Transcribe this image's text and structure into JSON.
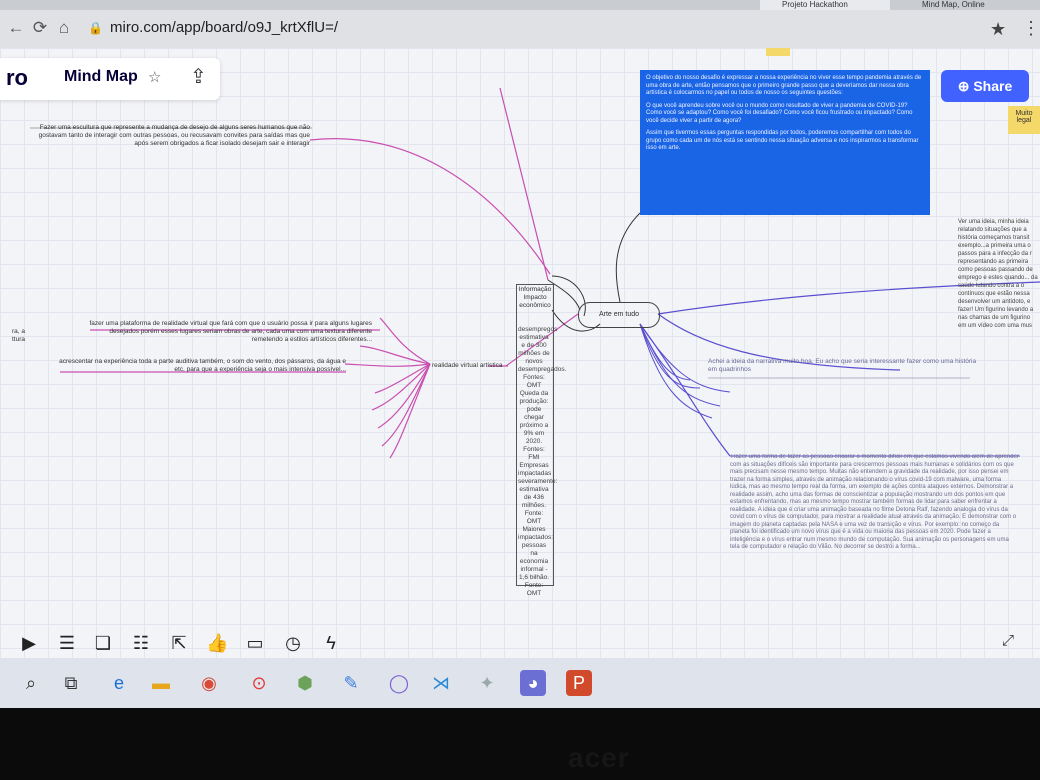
{
  "browser": {
    "tabs": [
      {
        "label": "Projeto Hackathon"
      },
      {
        "label": "Mind Map, Online"
      }
    ],
    "url": "miro.com/app/board/o9J_krtXflU=/"
  },
  "miro": {
    "logo": "ro",
    "board_title": "Mind Map",
    "share_label": "Share",
    "sticky_note": "Muito legal"
  },
  "mindmap": {
    "central": "Arte em tudo",
    "sub_node": "Informação Impacto econômico",
    "center_column": "desempregos estimativa e de 300 milhões de novos desempregados. Fontes: OMT Queda da produção: pode chegar próximo a 9% em 2020. Fontes: FMI Empresas impactadas severamente: estimativa de 436 milhões. Fonte: OMT Maiores impactados: pessoas na economia informal - 1,6 bilhão. Fonte: OMT",
    "branch_label": "realidade virtual artística",
    "left_text_1": "Fazer uma escultura que represente a mudança de desejo de alguns seres humanos que não gostavam tanto de interagir com outras pessoas, ou recusavam convites para saídas mas que após serem obrigados a ficar isolado desejam sair e interagir",
    "left_text_2": "fazer uma plataforma de realidade virtual que fará com que o usuário possa ir para alguns lugares desejados porém esses lugares seriam obras de arte, cada uma com uma textura diferente remetendo a estilos artísticos diferentes...",
    "left_text_3": "acrescentar na experiência toda a parte auditiva também, o som do vento, dos pássaros, da água e etc, para que a experiência seja o mais intensiva possível...",
    "left_edge": "ra, a ttura",
    "blue_card": [
      "O objetivo do nosso desafio é expressar a nossa experiência no viver esse tempo pandemia através de uma obra de arte, então pensamos que o primeiro grande passo que a deveríamos dar nessa obra artística é colocarmos no papel ou todos de nosso os seguintes questões:",
      "O que você aprendeu sobre você ou o mundo como resultado de viver a pandemia de COVID-19? Como você se adaptou? Como você foi desafiado? Como você ficou frustrado ou impactado? Como você decide viver a partir de agora?",
      "Assim que tivermos essas perguntas respondidas por todos, poderemos compartilhar com todos do grupo como cada um de nós está se sentindo nessa situação adversa e nos inspirarmos a transformar isso em arte."
    ],
    "right_text_1": "Achei a ideia da narrativa muito boa. Eu acho que seria interessante fazer como uma história em quadrinhos",
    "right_edge": "Ver uma ideia, minha ideia relatando situações que a história começamos transit exemplo...a primeira uma o passos para a infecção da r representando as primeira como pessoas passando de emprego e estes quando... da saúde lutando contra a o contínuos que estão nessa desenvolver um antídoto, e fazer! Um figurino levando a nas chamas de um figurino em um vídeo com uma mus",
    "right_long": "Trazer uma forma de fazer as pessoas encarar o momento difícil em que estamos vivendo além de aprender com as situações difíceis são importante para crescermos pessoas mais humanas e solidários com os que mais precisam nesse mesmo tempo. Muitas não entendem a gravidade da realidade, por isso pensei em trazer na forma simples, através de animação relacionando o vírus covid-19 com malware, uma forma lúdica, mas ao mesmo tempo real da forma, um exemplo de ações contra ataques externos. Demonstrar a realidade assim, acho uma das formas de conscientizar a população mostrando um dos pontos em que estamos enfrentando, mas ao mesmo tempo mostrar também formas de lidar para saber enfrentar a realidade. A ideia que é criar uma animação baseada no filme Detona Ralf, fazendo analogia do vírus da covid com o vírus de computador, para mostrar a realidade atual através da animação. E demonstrar com o imagem do planeta captadas pela NASA e uma vez de transição e vírus. Por exemplo: no começo da planeta foi identificado um novo vírus que é a vida ou maioria das pessoas em 2020. Pode fazer a inteligência e o vírus entrar num mesmo mundo de computação. Sua animação os personagens em uma tela de computador e relação do Vilão. No decorrer se destrói a forma..."
  },
  "toolbar": {
    "icons": [
      "present-icon",
      "comment-icon",
      "card-icon",
      "list-icon",
      "export-icon",
      "like-icon",
      "video-icon",
      "timer-icon",
      "voting-icon"
    ]
  },
  "taskbar": {
    "icons": [
      "search-icon",
      "task-view-icon",
      "edge-icon",
      "explorer-icon",
      "chrome-icon",
      "record-icon",
      "cube-icon",
      "pen-icon",
      "circle-icon",
      "vscode-icon",
      "puzzle-icon",
      "discord-icon",
      "powerpoint-icon"
    ]
  },
  "device": {
    "brand": "acer"
  }
}
